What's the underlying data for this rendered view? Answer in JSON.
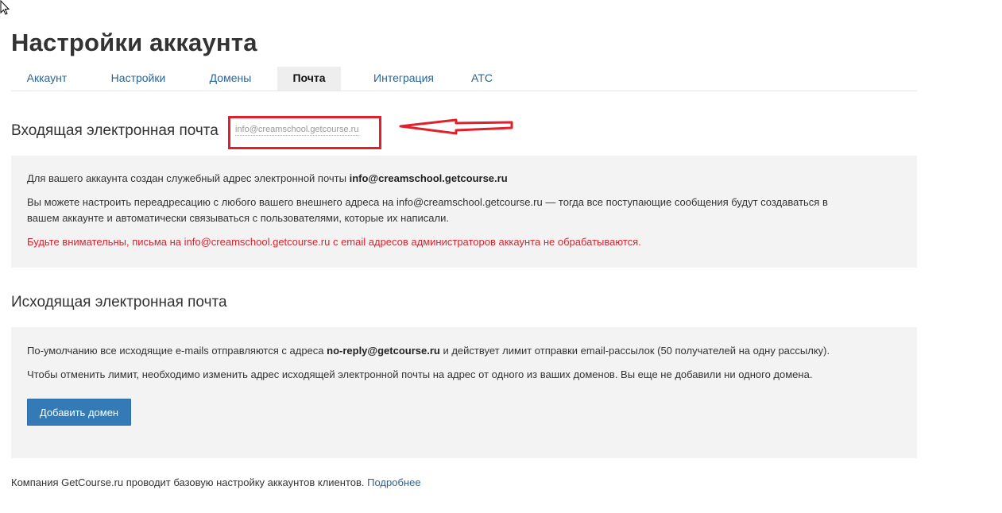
{
  "page": {
    "title": "Настройки аккаунта"
  },
  "tabs": [
    {
      "label": "Аккаунт",
      "active": false
    },
    {
      "label": "Настройки",
      "active": false
    },
    {
      "label": "Домены",
      "active": false
    },
    {
      "label": "Почта",
      "active": true
    },
    {
      "label": "Интеграция",
      "active": false
    },
    {
      "label": "АТС",
      "active": false
    }
  ],
  "incoming": {
    "title": "Входящая электронная почта",
    "email_value": "info@creamschool.getcourse.ru",
    "line1_prefix": "Для вашего аккаунта создан служебный адрес электронной почты ",
    "line1_email": "info@creamschool.getcourse.ru",
    "line2_part1": "Вы можете настроить переадресацию с любого вашего внешнего адреса на info@creamschool.getcourse.ru — тогда все поступающие сообщения будут создаваться в",
    "line2_part2": "вашем аккаунте и автоматически связываться с пользователями, которые их написали.",
    "warning": "Будьте внимательны, письма на info@creamschool.getcourse.ru с email адресов администраторов аккаунта не обрабатываются."
  },
  "outgoing": {
    "title": "Исходящая электронная почта",
    "line1_prefix": "По-умолчанию все исходящие e-mails отправляются с адреса ",
    "line1_email": "no-reply@getcourse.ru",
    "line1_suffix": " и действует лимит отправки email-рассылок (50 получателей на одну рассылку).",
    "line2": "Чтобы отменить лимит, необходимо изменить адрес исходящей электронной почты на адрес от одного из ваших доменов. Вы еще не добавили ни одного домена.",
    "add_domain_button": "Добавить домен"
  },
  "footer": {
    "text": "Компания GetCourse.ru проводит базовую настройку аккаунтов клиентов. ",
    "link": "Подробнее"
  },
  "colors": {
    "accent": "#337ab7",
    "link": "#2a6496",
    "warning": "#d9232f",
    "annotation": "#e0202a",
    "panel_bg": "#f3f3f3"
  },
  "icons": {
    "cursor": "mouse-pointer-icon",
    "annotation_arrow": "left-arrow-icon"
  }
}
